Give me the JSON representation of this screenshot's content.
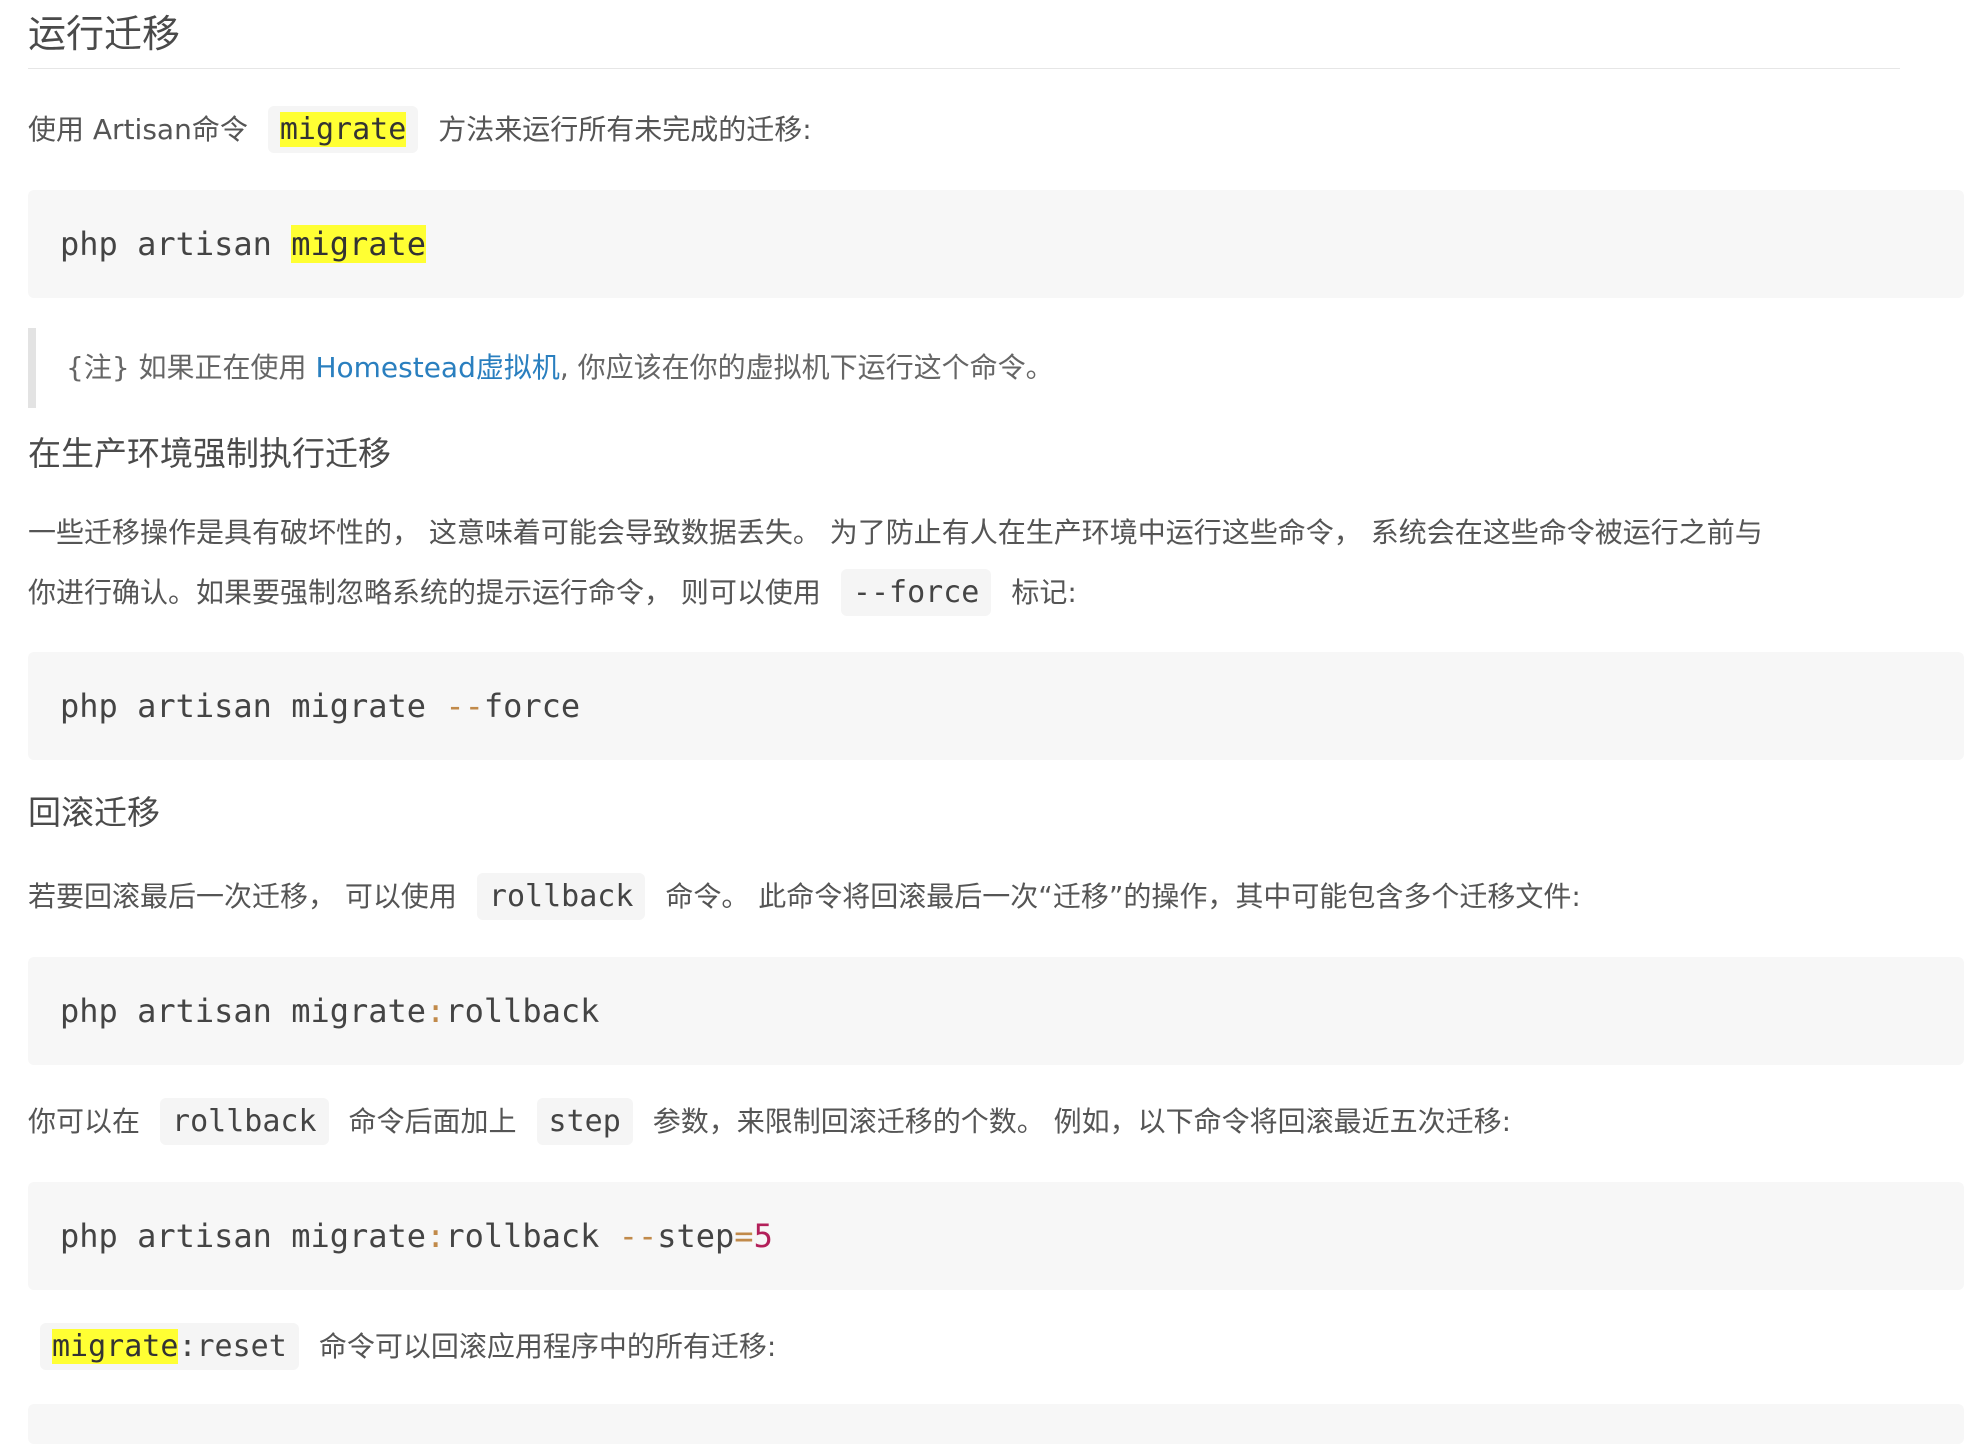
{
  "section_run": {
    "title": "运行迁移",
    "intro_before": "使用 Artisan命令",
    "intro_code": "migrate",
    "intro_after": "方法来运行所有未完成的迁移:",
    "code1_prefix": "php artisan ",
    "code1_hl": "migrate",
    "note_prefix": "{注} 如果正在使用 ",
    "note_link": "Homestead虚拟机",
    "note_suffix": ", 你应该在你的虚拟机下运行这个命令。"
  },
  "section_force": {
    "title": "在生产环境强制执行迁移",
    "line1": "一些迁移操作是具有破坏性的， 这意味着可能会导致数据丢失。 为了防止有人在生产环境中运行这些命令， 系统会在这些命令被运行之前与",
    "line2_before": "你进行确认。如果要强制忽略系统的提示运行命令， 则可以使用",
    "line2_code": "--force",
    "line2_after": "标记:",
    "code_prefix": "php artisan migrate ",
    "code_op": "--",
    "code_rest": "force"
  },
  "section_rollback": {
    "title": "回滚迁移",
    "para1_before": "若要回滚最后一次迁移， 可以使用",
    "para1_code": "rollback",
    "para1_after": "命令。 此命令将回滚最后一次“迁移”的操作，其中可能包含多个迁移文件:",
    "code1_prefix": "php artisan migrate",
    "code1_colon": ":",
    "code1_rest": "rollback",
    "para2_before": "你可以在",
    "para2_code1": "rollback",
    "para2_mid": "命令后面加上",
    "para2_code2": "step",
    "para2_after": "参数，来限制回滚迁移的个数。 例如，以下命令将回滚最近五次迁移:",
    "code2_prefix": "php artisan migrate",
    "code2_colon": ":",
    "code2_cmd": "rollback ",
    "code2_op": "--",
    "code2_flag": "step",
    "code2_eq": "=",
    "code2_num": "5",
    "para3_code_hl": "migrate",
    "para3_code_rest": ":reset",
    "para3_after": "命令可以回滚应用程序中的所有迁移:"
  }
}
